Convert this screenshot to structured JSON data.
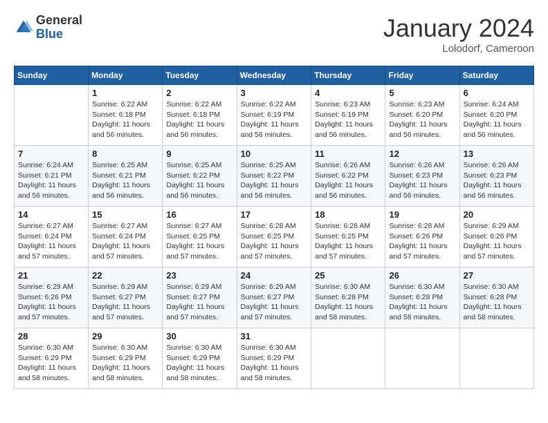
{
  "header": {
    "logo_general": "General",
    "logo_blue": "Blue",
    "title": "January 2024",
    "location": "Lolodorf, Cameroon"
  },
  "weekdays": [
    "Sunday",
    "Monday",
    "Tuesday",
    "Wednesday",
    "Thursday",
    "Friday",
    "Saturday"
  ],
  "weeks": [
    [
      {
        "day": "",
        "sunrise": "",
        "sunset": "",
        "daylight": ""
      },
      {
        "day": "1",
        "sunrise": "Sunrise: 6:22 AM",
        "sunset": "Sunset: 6:18 PM",
        "daylight": "Daylight: 11 hours and 56 minutes."
      },
      {
        "day": "2",
        "sunrise": "Sunrise: 6:22 AM",
        "sunset": "Sunset: 6:18 PM",
        "daylight": "Daylight: 11 hours and 56 minutes."
      },
      {
        "day": "3",
        "sunrise": "Sunrise: 6:22 AM",
        "sunset": "Sunset: 6:19 PM",
        "daylight": "Daylight: 11 hours and 56 minutes."
      },
      {
        "day": "4",
        "sunrise": "Sunrise: 6:23 AM",
        "sunset": "Sunset: 6:19 PM",
        "daylight": "Daylight: 11 hours and 56 minutes."
      },
      {
        "day": "5",
        "sunrise": "Sunrise: 6:23 AM",
        "sunset": "Sunset: 6:20 PM",
        "daylight": "Daylight: 11 hours and 56 minutes."
      },
      {
        "day": "6",
        "sunrise": "Sunrise: 6:24 AM",
        "sunset": "Sunset: 6:20 PM",
        "daylight": "Daylight: 11 hours and 56 minutes."
      }
    ],
    [
      {
        "day": "7",
        "sunrise": "Sunrise: 6:24 AM",
        "sunset": "Sunset: 6:21 PM",
        "daylight": "Daylight: 11 hours and 56 minutes."
      },
      {
        "day": "8",
        "sunrise": "Sunrise: 6:25 AM",
        "sunset": "Sunset: 6:21 PM",
        "daylight": "Daylight: 11 hours and 56 minutes."
      },
      {
        "day": "9",
        "sunrise": "Sunrise: 6:25 AM",
        "sunset": "Sunset: 6:22 PM",
        "daylight": "Daylight: 11 hours and 56 minutes."
      },
      {
        "day": "10",
        "sunrise": "Sunrise: 6:25 AM",
        "sunset": "Sunset: 6:22 PM",
        "daylight": "Daylight: 11 hours and 56 minutes."
      },
      {
        "day": "11",
        "sunrise": "Sunrise: 6:26 AM",
        "sunset": "Sunset: 6:22 PM",
        "daylight": "Daylight: 11 hours and 56 minutes."
      },
      {
        "day": "12",
        "sunrise": "Sunrise: 6:26 AM",
        "sunset": "Sunset: 6:23 PM",
        "daylight": "Daylight: 11 hours and 56 minutes."
      },
      {
        "day": "13",
        "sunrise": "Sunrise: 6:26 AM",
        "sunset": "Sunset: 6:23 PM",
        "daylight": "Daylight: 11 hours and 56 minutes."
      }
    ],
    [
      {
        "day": "14",
        "sunrise": "Sunrise: 6:27 AM",
        "sunset": "Sunset: 6:24 PM",
        "daylight": "Daylight: 11 hours and 57 minutes."
      },
      {
        "day": "15",
        "sunrise": "Sunrise: 6:27 AM",
        "sunset": "Sunset: 6:24 PM",
        "daylight": "Daylight: 11 hours and 57 minutes."
      },
      {
        "day": "16",
        "sunrise": "Sunrise: 6:27 AM",
        "sunset": "Sunset: 6:25 PM",
        "daylight": "Daylight: 11 hours and 57 minutes."
      },
      {
        "day": "17",
        "sunrise": "Sunrise: 6:28 AM",
        "sunset": "Sunset: 6:25 PM",
        "daylight": "Daylight: 11 hours and 57 minutes."
      },
      {
        "day": "18",
        "sunrise": "Sunrise: 6:28 AM",
        "sunset": "Sunset: 6:25 PM",
        "daylight": "Daylight: 11 hours and 57 minutes."
      },
      {
        "day": "19",
        "sunrise": "Sunrise: 6:28 AM",
        "sunset": "Sunset: 6:26 PM",
        "daylight": "Daylight: 11 hours and 57 minutes."
      },
      {
        "day": "20",
        "sunrise": "Sunrise: 6:29 AM",
        "sunset": "Sunset: 6:26 PM",
        "daylight": "Daylight: 11 hours and 57 minutes."
      }
    ],
    [
      {
        "day": "21",
        "sunrise": "Sunrise: 6:29 AM",
        "sunset": "Sunset: 6:26 PM",
        "daylight": "Daylight: 11 hours and 57 minutes."
      },
      {
        "day": "22",
        "sunrise": "Sunrise: 6:29 AM",
        "sunset": "Sunset: 6:27 PM",
        "daylight": "Daylight: 11 hours and 57 minutes."
      },
      {
        "day": "23",
        "sunrise": "Sunrise: 6:29 AM",
        "sunset": "Sunset: 6:27 PM",
        "daylight": "Daylight: 11 hours and 57 minutes."
      },
      {
        "day": "24",
        "sunrise": "Sunrise: 6:29 AM",
        "sunset": "Sunset: 6:27 PM",
        "daylight": "Daylight: 11 hours and 57 minutes."
      },
      {
        "day": "25",
        "sunrise": "Sunrise: 6:30 AM",
        "sunset": "Sunset: 6:28 PM",
        "daylight": "Daylight: 11 hours and 58 minutes."
      },
      {
        "day": "26",
        "sunrise": "Sunrise: 6:30 AM",
        "sunset": "Sunset: 6:28 PM",
        "daylight": "Daylight: 11 hours and 58 minutes."
      },
      {
        "day": "27",
        "sunrise": "Sunrise: 6:30 AM",
        "sunset": "Sunset: 6:28 PM",
        "daylight": "Daylight: 11 hours and 58 minutes."
      }
    ],
    [
      {
        "day": "28",
        "sunrise": "Sunrise: 6:30 AM",
        "sunset": "Sunset: 6:29 PM",
        "daylight": "Daylight: 11 hours and 58 minutes."
      },
      {
        "day": "29",
        "sunrise": "Sunrise: 6:30 AM",
        "sunset": "Sunset: 6:29 PM",
        "daylight": "Daylight: 11 hours and 58 minutes."
      },
      {
        "day": "30",
        "sunrise": "Sunrise: 6:30 AM",
        "sunset": "Sunset: 6:29 PM",
        "daylight": "Daylight: 11 hours and 58 minutes."
      },
      {
        "day": "31",
        "sunrise": "Sunrise: 6:30 AM",
        "sunset": "Sunset: 6:29 PM",
        "daylight": "Daylight: 11 hours and 58 minutes."
      },
      {
        "day": "",
        "sunrise": "",
        "sunset": "",
        "daylight": ""
      },
      {
        "day": "",
        "sunrise": "",
        "sunset": "",
        "daylight": ""
      },
      {
        "day": "",
        "sunrise": "",
        "sunset": "",
        "daylight": ""
      }
    ]
  ]
}
